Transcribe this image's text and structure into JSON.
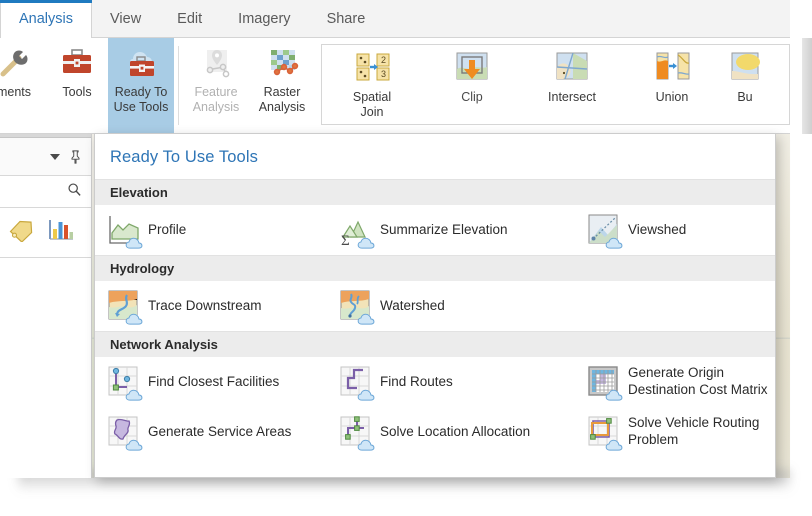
{
  "window": {
    "app_title": "Ready To Use Tools"
  },
  "tabs": [
    {
      "label": "Analysis",
      "active": true
    },
    {
      "label": "View",
      "active": false
    },
    {
      "label": "Edit",
      "active": false
    },
    {
      "label": "Imagery",
      "active": false
    },
    {
      "label": "Share",
      "active": false
    }
  ],
  "ribbon": {
    "buttons": [
      {
        "label": "ments",
        "icon": "wrench-hammer-icon",
        "state": "truncated"
      },
      {
        "label": "Tools",
        "icon": "toolbox-icon",
        "state": "normal"
      },
      {
        "label": "Ready To\nUse Tools",
        "icon": "cloud-toolbox-icon",
        "state": "selected",
        "has_dropdown": true
      },
      {
        "label": "Feature\nAnalysis",
        "icon": "feature-analysis-icon",
        "state": "disabled",
        "has_dropdown": true
      },
      {
        "label": "Raster\nAnalysis",
        "icon": "raster-analysis-icon",
        "state": "normal",
        "has_dropdown": true
      }
    ],
    "gallery": [
      {
        "label": "Spatial\nJoin",
        "icon": "spatial-join-icon"
      },
      {
        "label": "Clip",
        "icon": "clip-icon"
      },
      {
        "label": "Intersect",
        "icon": "intersect-icon"
      },
      {
        "label": "Union",
        "icon": "union-icon"
      },
      {
        "label": "Bu",
        "icon": "buffer-icon"
      }
    ]
  },
  "left_panel": {
    "icons": [
      "chevron-down-icon",
      "pin-icon",
      "search-icon",
      "tag-icon",
      "bar-chart-icon"
    ]
  },
  "dropdown": {
    "title": "Ready To Use Tools",
    "sections": [
      {
        "header": "Elevation",
        "rows": [
          [
            {
              "label": "Profile",
              "icon": "profile-icon"
            },
            {
              "label": "Summarize Elevation",
              "icon": "summarize-elevation-icon"
            },
            {
              "label": "Viewshed",
              "icon": "viewshed-icon"
            }
          ]
        ]
      },
      {
        "header": "Hydrology",
        "rows": [
          [
            {
              "label": "Trace Downstream",
              "icon": "trace-downstream-icon"
            },
            {
              "label": "Watershed",
              "icon": "watershed-icon"
            }
          ]
        ]
      },
      {
        "header": "Network Analysis",
        "rows": [
          [
            {
              "label": "Find Closest Facilities",
              "icon": "find-closest-facilities-icon"
            },
            {
              "label": "Find Routes",
              "icon": "find-routes-icon"
            },
            {
              "label": "Generate Origin\nDestination Cost Matrix",
              "icon": "origin-destination-matrix-icon"
            }
          ],
          [
            {
              "label": "Generate Service Areas",
              "icon": "generate-service-areas-icon"
            },
            {
              "label": "Solve Location Allocation",
              "icon": "solve-location-allocation-icon"
            },
            {
              "label": "Solve Vehicle Routing\nProblem",
              "icon": "solve-vehicle-routing-icon"
            }
          ]
        ]
      }
    ]
  },
  "colors": {
    "accent": "#2e75b6",
    "tab_underline": "#1f7ac0",
    "selected_button": "#a8cce5",
    "section_band": "#ececec",
    "toolbox_red": "#c0452b"
  }
}
